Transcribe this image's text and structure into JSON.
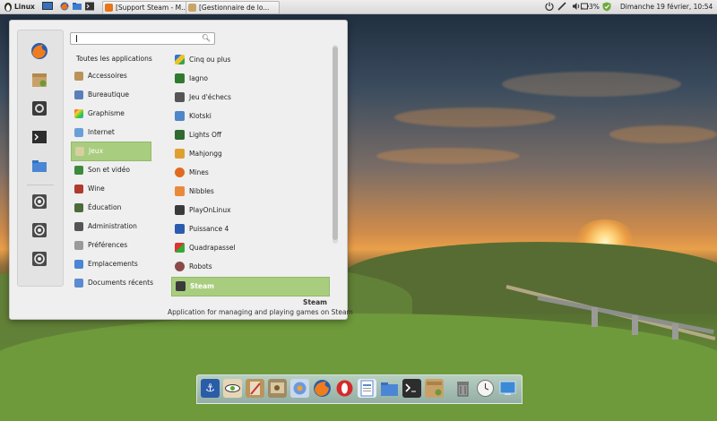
{
  "top_panel": {
    "menu_label": "Linux",
    "tasks": [
      {
        "label": "[Support Steam - M...",
        "icon": "firefox-icon"
      },
      {
        "label": "[Gestionnaire de lo...",
        "icon": "package-icon"
      }
    ],
    "battery": "3%",
    "clock": "Dimanche 19 février, 10:54"
  },
  "menu": {
    "search": {
      "value": "",
      "placeholder": ""
    },
    "favorites": [
      "firefox-icon",
      "package-manager-icon",
      "settings-icon",
      "terminal-icon",
      "folder-icon",
      "lock-screen-icon",
      "logout-icon",
      "shutdown-icon"
    ],
    "categories": [
      {
        "label": "Toutes les applications",
        "icon": ""
      },
      {
        "label": "Accessoires",
        "icon": "accessories-icon"
      },
      {
        "label": "Bureautique",
        "icon": "office-icon"
      },
      {
        "label": "Graphisme",
        "icon": "graphics-icon"
      },
      {
        "label": "Internet",
        "icon": "internet-icon"
      },
      {
        "label": "Jeux",
        "icon": "games-icon",
        "selected": true
      },
      {
        "label": "Son et vidéo",
        "icon": "multimedia-icon"
      },
      {
        "label": "Wine",
        "icon": "wine-icon"
      },
      {
        "label": "Éducation",
        "icon": "education-icon"
      },
      {
        "label": "Administration",
        "icon": "administration-icon"
      },
      {
        "label": "Préférences",
        "icon": "preferences-icon"
      },
      {
        "label": "Emplacements",
        "icon": "places-icon"
      },
      {
        "label": "Documents récents",
        "icon": "recent-documents-icon"
      }
    ],
    "apps": [
      {
        "label": "Cinq ou plus",
        "icon": "five-or-more-icon"
      },
      {
        "label": "Iagno",
        "icon": "iagno-icon"
      },
      {
        "label": "Jeu d'échecs",
        "icon": "chess-icon"
      },
      {
        "label": "Klotski",
        "icon": "klotski-icon"
      },
      {
        "label": "Lights Off",
        "icon": "lights-off-icon"
      },
      {
        "label": "Mahjongg",
        "icon": "mahjongg-icon"
      },
      {
        "label": "Mines",
        "icon": "mines-icon"
      },
      {
        "label": "Nibbles",
        "icon": "nibbles-icon"
      },
      {
        "label": "PlayOnLinux",
        "icon": "playonlinux-icon"
      },
      {
        "label": "Puissance 4",
        "icon": "four-in-a-row-icon"
      },
      {
        "label": "Quadrapassel",
        "icon": "quadrapassel-icon"
      },
      {
        "label": "Robots",
        "icon": "robots-icon"
      },
      {
        "label": "Steam",
        "icon": "steam-icon",
        "selected": true
      }
    ],
    "description": {
      "title": "Steam",
      "text": "Application for managing and playing games on Steam"
    }
  },
  "dock": {
    "items": [
      "anchor-icon",
      "eye-icon",
      "paint-icon",
      "image-editor-icon",
      "network-icon",
      "firefox-icon",
      "opera-icon",
      "writer-icon",
      "folder-icon",
      "terminal-icon",
      "package-icon",
      "trash-icon",
      "clock-icon",
      "desktop-icon"
    ]
  },
  "colors": {
    "selection": "#a9cd7e",
    "menu_bg": "#efefef"
  }
}
